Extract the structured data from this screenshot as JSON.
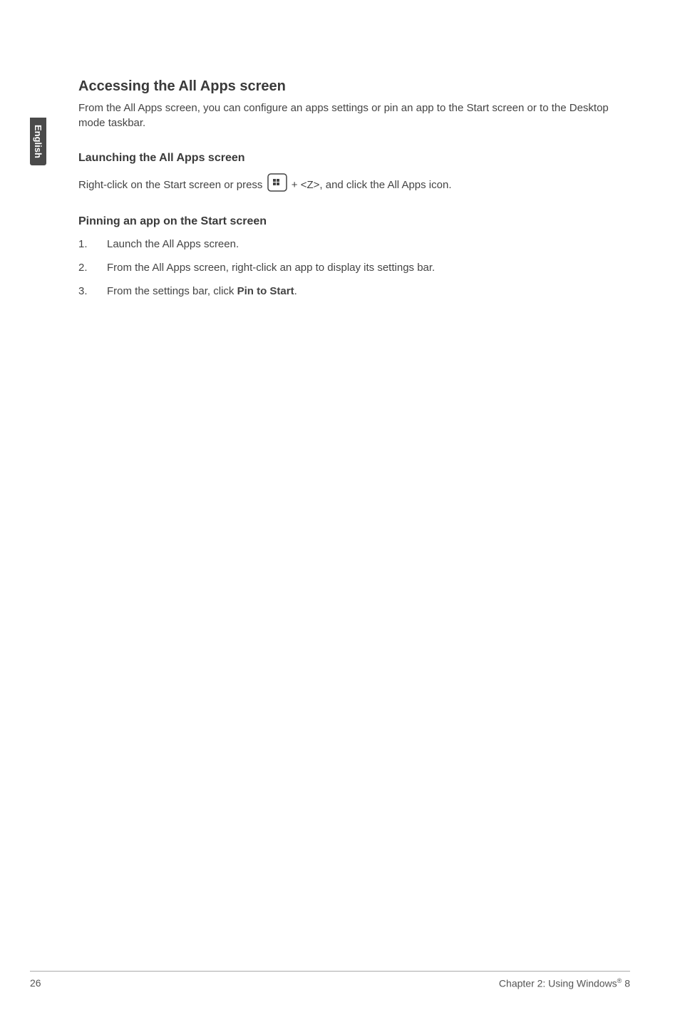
{
  "sidebar": {
    "language": "English"
  },
  "main": {
    "heading": "Accessing the All Apps screen",
    "intro": "From the All Apps screen, you can configure an apps settings or pin an app to the Start screen or to the Desktop mode taskbar.",
    "section1": {
      "heading": "Launching the All Apps screen",
      "text_before": "Right-click on the Start screen or press ",
      "text_after": " + <Z>, and click the All Apps icon."
    },
    "section2": {
      "heading": "Pinning an app on the Start screen",
      "steps": [
        {
          "num": "1.",
          "text": "Launch the All Apps screen."
        },
        {
          "num": "2.",
          "text": "From the All Apps screen, right-click an app to display its settings bar."
        },
        {
          "num": "3.",
          "text_before": "From the settings bar, click ",
          "bold": "Pin to Start",
          "text_after": "."
        }
      ]
    }
  },
  "footer": {
    "page": "26",
    "chapter_before": "Chapter 2: Using Windows",
    "chapter_after": " 8"
  }
}
